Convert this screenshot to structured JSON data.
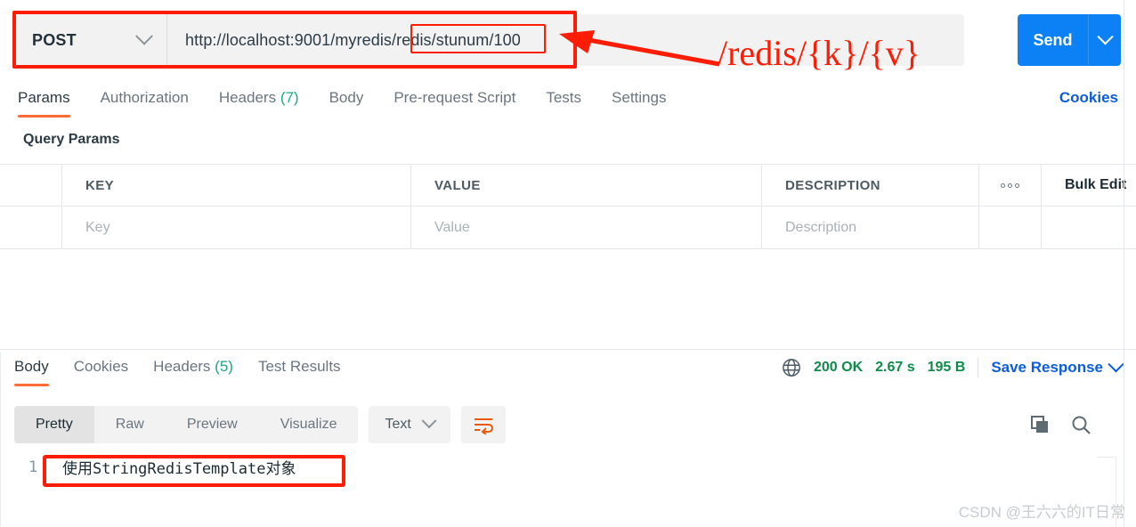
{
  "request": {
    "method": "POST",
    "url": "http://localhost:9001/myredis/redis/stunum/100",
    "url_prefix": "http://localhost:9001/myredis/",
    "url_highlight": "redis/stunum/100",
    "send_label": "Send",
    "annotation": "/redis/{k}/{v}",
    "tabs": [
      {
        "label": "Params",
        "count": "",
        "active": true
      },
      {
        "label": "Authorization",
        "count": "",
        "active": false
      },
      {
        "label": "Headers",
        "count": "(7)",
        "active": false
      },
      {
        "label": "Body",
        "count": "",
        "active": false
      },
      {
        "label": "Pre-request Script",
        "count": "",
        "active": false
      },
      {
        "label": "Tests",
        "count": "",
        "active": false
      },
      {
        "label": "Settings",
        "count": "",
        "active": false
      }
    ],
    "cookies_link": "Cookies",
    "section_title": "Query Params"
  },
  "params_table": {
    "headers": {
      "key": "KEY",
      "value": "VALUE",
      "description": "DESCRIPTION",
      "bulk_edit": "Bulk Edit",
      "more_icon": "more-options-icon"
    },
    "row": {
      "key_placeholder": "Key",
      "value_placeholder": "Value",
      "description_placeholder": "Description"
    }
  },
  "response": {
    "tabs": [
      {
        "label": "Body",
        "count": "",
        "active": true
      },
      {
        "label": "Cookies",
        "count": "",
        "active": false
      },
      {
        "label": "Headers",
        "count": "(5)",
        "active": false
      },
      {
        "label": "Test Results",
        "count": "",
        "active": false
      }
    ],
    "status": {
      "code": "200 OK",
      "time": "2.67 s",
      "size": "195 B",
      "globe_icon": "globe-icon"
    },
    "save_label": "Save Response",
    "format_tabs": [
      {
        "label": "Pretty",
        "active": true
      },
      {
        "label": "Raw",
        "active": false
      },
      {
        "label": "Preview",
        "active": false
      },
      {
        "label": "Visualize",
        "active": false
      }
    ],
    "content_type": "Text",
    "wrap_icon": "word-wrap-icon",
    "copy_icon": "copy-icon",
    "search_icon": "search-icon",
    "body_lines": [
      {
        "number": "1",
        "text": "使用StringRedisTemplate对象"
      }
    ]
  },
  "watermark": "CSDN @王六六的IT日常",
  "colors": {
    "accent_orange": "#ff6c37",
    "send_blue": "#0c81f6",
    "link_blue": "#0c5ddb",
    "status_green": "#0f8a4a",
    "annotation_red": "#fc1d04",
    "count_green": "#1ba97f"
  }
}
